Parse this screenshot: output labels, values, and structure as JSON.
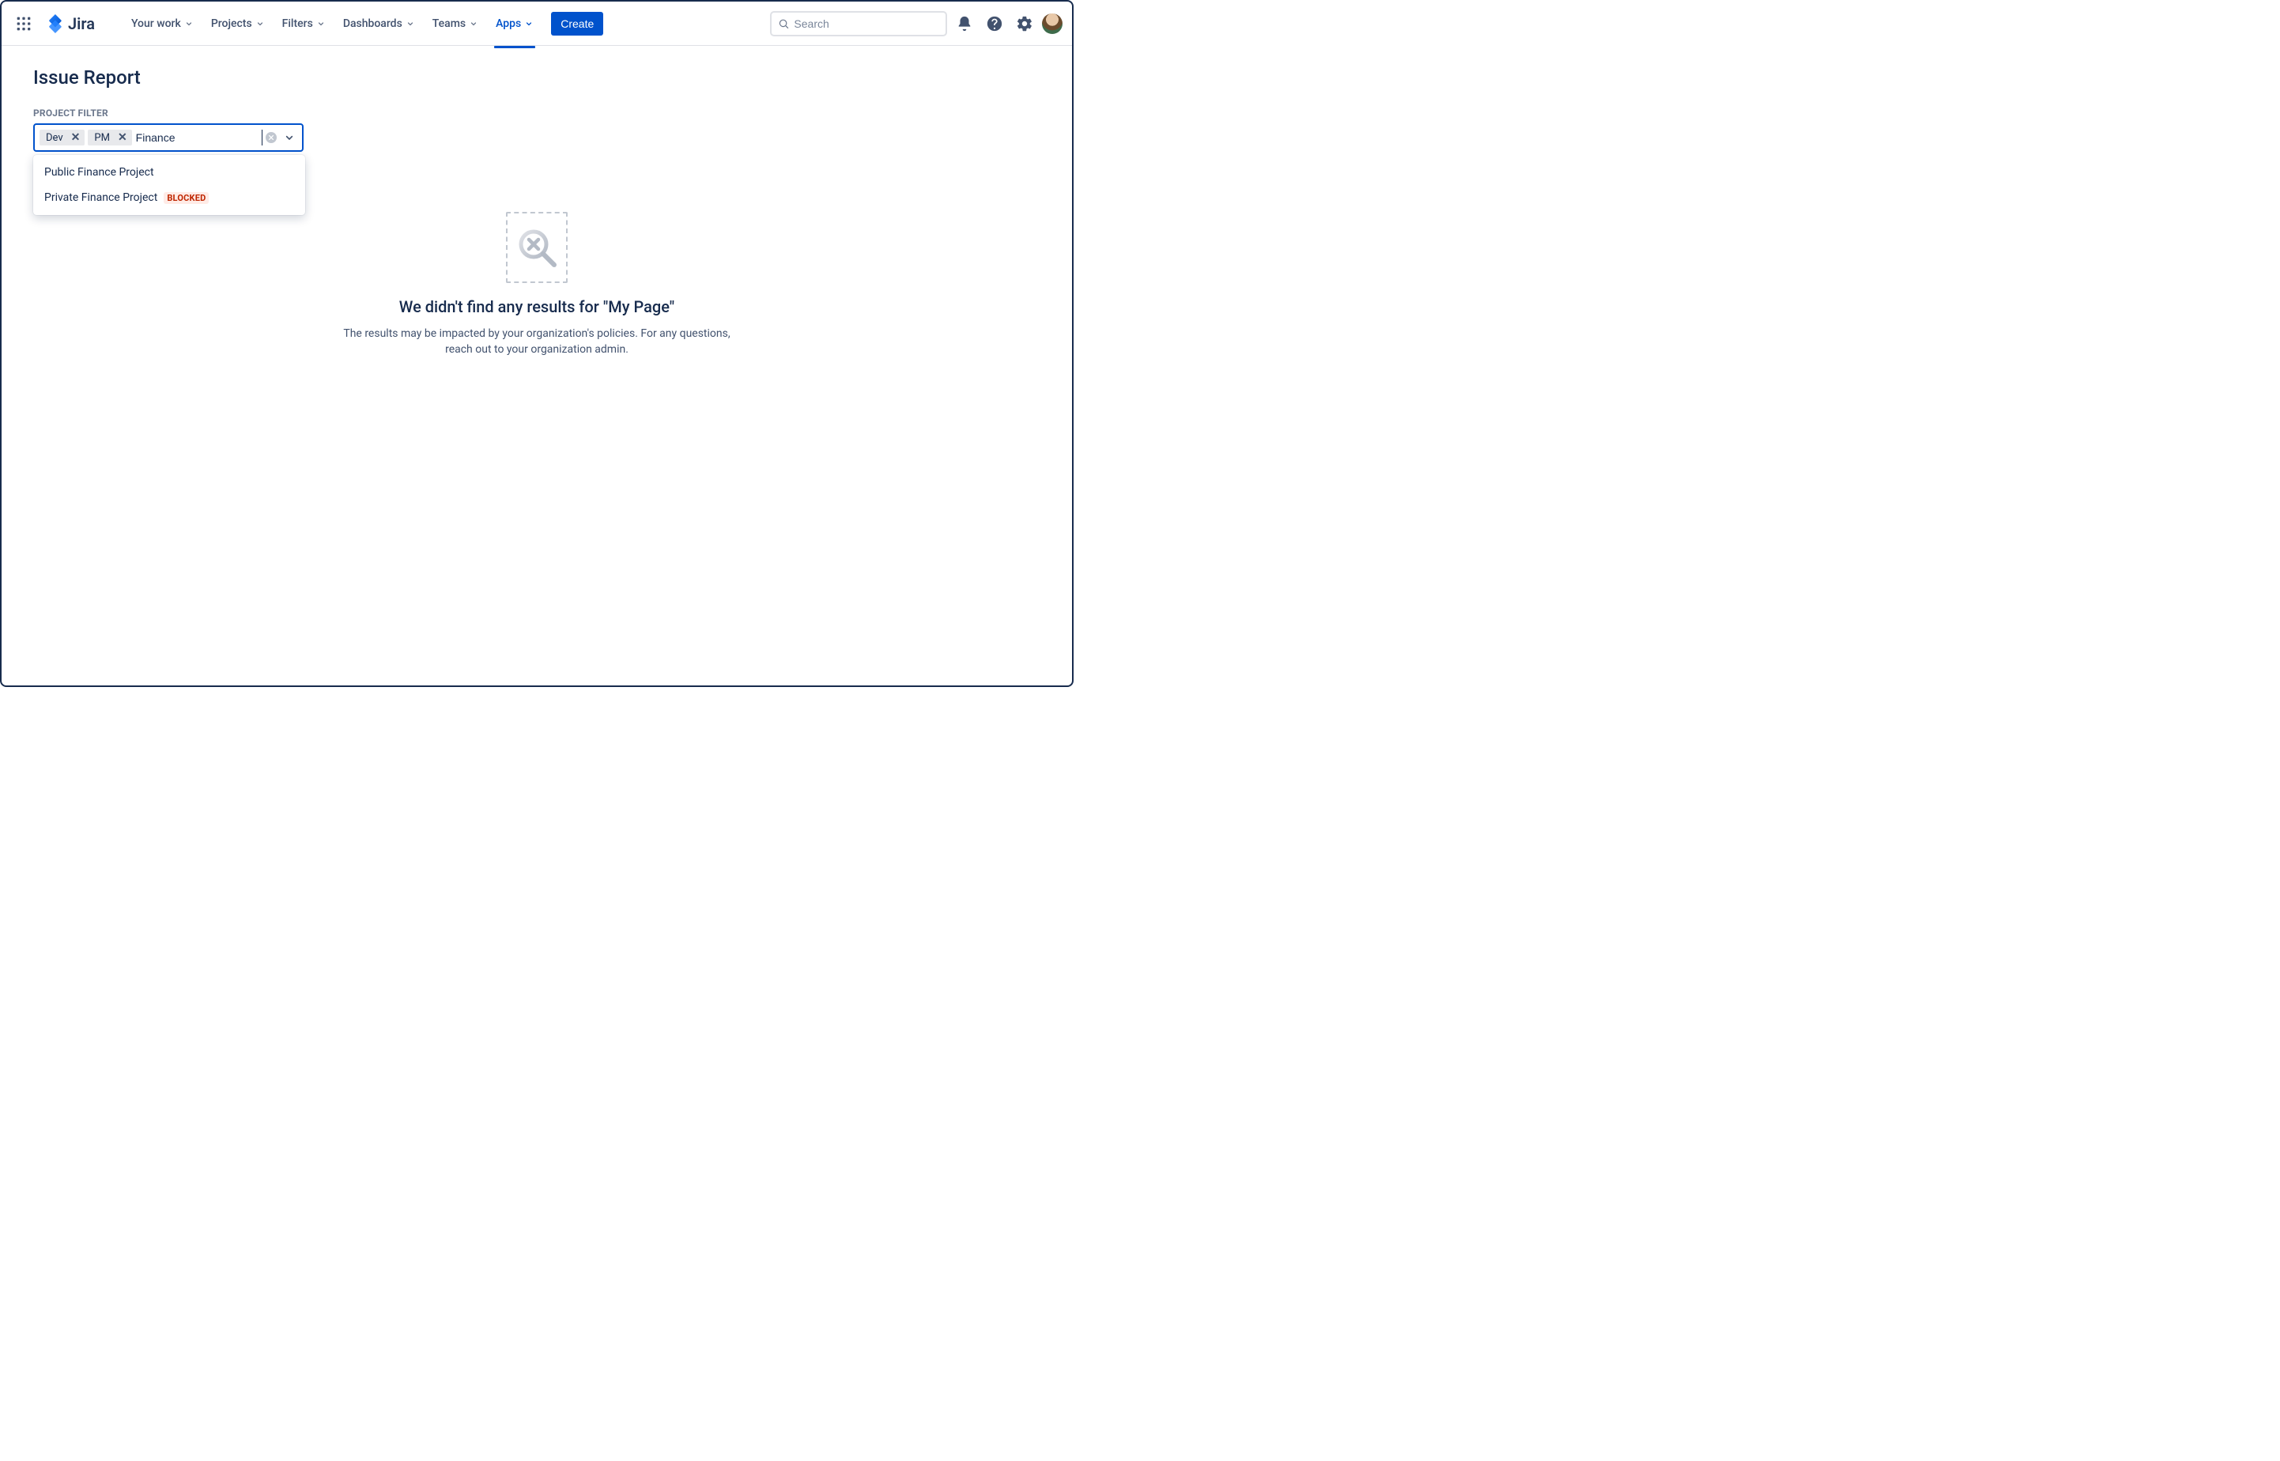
{
  "product": {
    "name": "Jira"
  },
  "nav": {
    "items": [
      {
        "label": "Your work",
        "active": false
      },
      {
        "label": "Projects",
        "active": false
      },
      {
        "label": "Filters",
        "active": false
      },
      {
        "label": "Dashboards",
        "active": false
      },
      {
        "label": "Teams",
        "active": false
      },
      {
        "label": "Apps",
        "active": true
      }
    ],
    "create_label": "Create"
  },
  "search": {
    "placeholder": "Search"
  },
  "page": {
    "title": "Issue Report",
    "filter_label": "Project Filter"
  },
  "project_filter": {
    "chips": [
      {
        "label": "Dev"
      },
      {
        "label": "PM"
      }
    ],
    "input_value": "Finance",
    "options": [
      {
        "label": "Public Finance Project",
        "blocked": false
      },
      {
        "label": "Private Finance Project",
        "blocked": true,
        "blocked_label": "BLOCKED"
      }
    ]
  },
  "empty_state": {
    "title": "We didn't find any results for \"My Page\"",
    "description": "The results may be impacted by your organization's policies. For any questions, reach out to your organization admin."
  }
}
